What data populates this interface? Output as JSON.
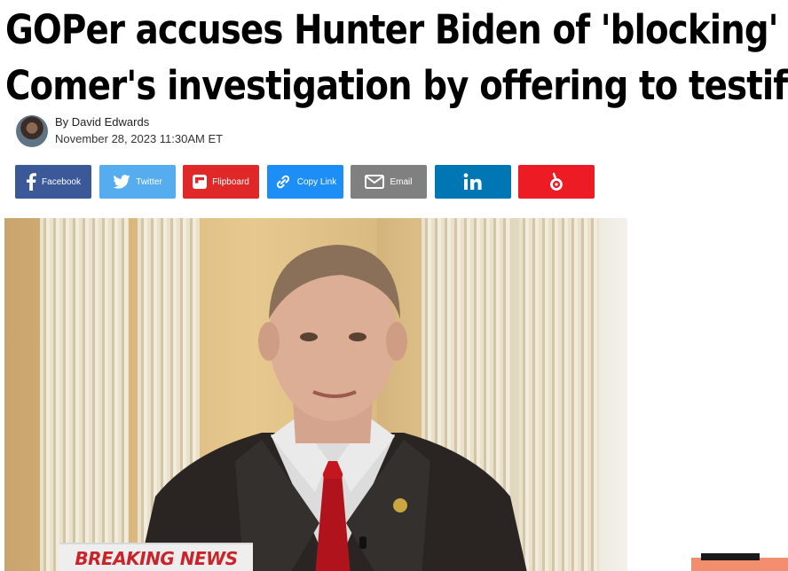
{
  "article": {
    "headline_line1": "GOPer accuses Hunter Biden of 'blocking'",
    "headline_line2": "Comer's investigation by offering to testify",
    "author": "By David Edwards",
    "date": "November 28, 2023 11:30AM ET"
  },
  "share": {
    "buttons": [
      {
        "name": "facebook",
        "label": "Facebook",
        "color": "#3b5998",
        "icon": "facebook-icon"
      },
      {
        "name": "twitter",
        "label": "Twitter",
        "color": "#55acee",
        "icon": "twitter-bird-icon"
      },
      {
        "name": "flipboard",
        "label": "Flipboard",
        "color": "#e12828",
        "icon": "flipboard-icon"
      },
      {
        "name": "copy-link",
        "label": "Copy Link",
        "color": "#1c8ef5",
        "icon": "link-icon"
      },
      {
        "name": "email",
        "label": "Email",
        "color": "#808080",
        "icon": "envelope-icon"
      },
      {
        "name": "linkedin",
        "label": "",
        "color": "#0077b5",
        "icon": "linkedin-icon"
      },
      {
        "name": "bookmark",
        "label": "",
        "color": "#ed1c24",
        "icon": "bookmark-service-icon"
      }
    ]
  },
  "hero": {
    "banner": "BREAKING NEWS"
  }
}
